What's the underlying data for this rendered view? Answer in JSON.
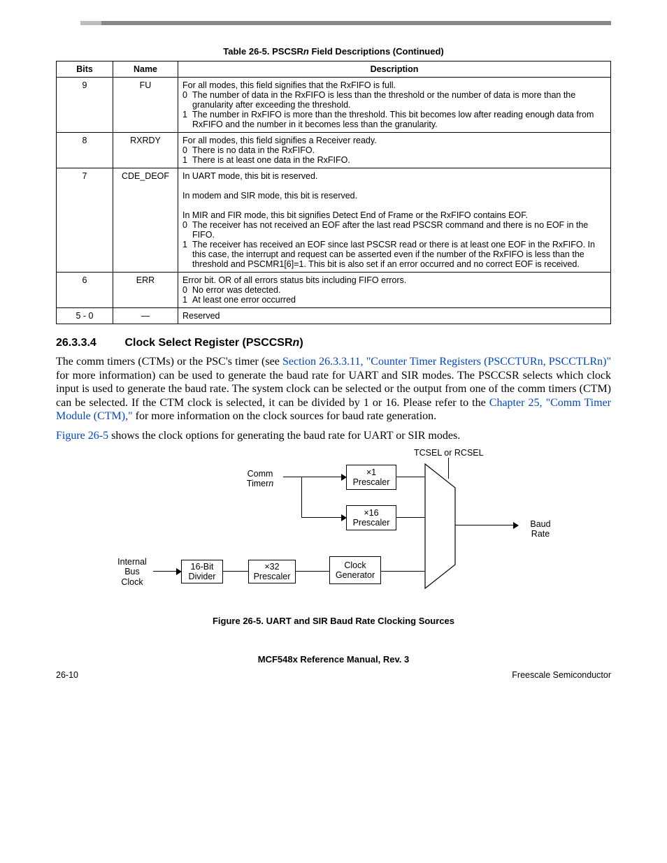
{
  "tableCaption": "Table 26-5. PSCSRn Field Descriptions (Continued)",
  "tableCaptionItalic": "n",
  "th": {
    "bits": "Bits",
    "name": "Name",
    "desc": "Description"
  },
  "rows": [
    {
      "bits": "9",
      "name": "FU",
      "lead": "For all modes, this field signifies that the RxFIFO is full.",
      "items": [
        {
          "n": "0",
          "t": "The number of data in the RxFIFO is less than the threshold or the number of data is more than the granularity after exceeding the threshold."
        },
        {
          "n": "1",
          "t": "The number in RxFIFO is more than the threshold. This bit becomes low after reading enough data from RxFIFO and the number in it becomes less than the granularity."
        }
      ]
    },
    {
      "bits": "8",
      "name": "RXRDY",
      "lead": "For all modes, this field signifies a Receiver ready.",
      "items": [
        {
          "n": "0",
          "t": "There is no data in the RxFIFO."
        },
        {
          "n": "1",
          "t": "There is at least one data in the RxFIFO."
        }
      ]
    },
    {
      "bits": "7",
      "name": "CDE_DEOF",
      "paras": [
        "In UART mode, this bit is reserved.",
        "In modem and SIR mode, this bit is reserved.",
        "In MIR and FIR mode, this bit signifies Detect End of Frame or the RxFIFO contains EOF."
      ],
      "items": [
        {
          "n": "0",
          "t": "The receiver has not received an EOF after the last read PSCSR command and there is no EOF in the FIFO."
        },
        {
          "n": "1",
          "t": "The receiver has received an EOF since last PSCSR read or there is at least one EOF in the RxFIFO. In this case, the interrupt and request can be asserted even if the number of the RxFIFO is less than the threshold and PSCMR1[6]=1. This bit is also set if an error occurred and no correct EOF is received."
        }
      ]
    },
    {
      "bits": "6",
      "name": "ERR",
      "lead": "Error bit. OR of all errors status bits including FIFO errors.",
      "items": [
        {
          "n": "0",
          "t": "No error was detected."
        },
        {
          "n": "1",
          "t": "At least one error occurred"
        }
      ]
    },
    {
      "bits": "5 - 0",
      "name": "—",
      "lead": "Reserved"
    }
  ],
  "section": {
    "num": "26.3.3.4",
    "title_a": "Clock Select Register (PSCCSR",
    "title_ital": "n",
    "title_b": ")"
  },
  "para1": {
    "a": "The comm timers (CTMs) or the PSC's timer (see ",
    "link1": "Section 26.3.3.11, \"Counter Timer Registers (PSCCTURn, PSCCTLRn)\"",
    "b": " for more information) can be used to generate the baud rate for UART and SIR modes. The PSCCSR selects which clock input is used to generate the baud rate. The system clock can be selected or the output from one of the comm timers (CTM) can be selected. If the CTM clock is selected, it can be divided by 1 or 16. Please refer to the ",
    "link2": "Chapter 25, \"Comm Timer Module (CTM),\"",
    "c": " for more information on the clock sources for baud rate generation."
  },
  "para2": {
    "link": "Figure 26-5",
    "rest": " shows the clock options for generating the baud rate for UART or SIR modes."
  },
  "diagram": {
    "tclabel": "TCSEL or RCSEL",
    "comm": "Comm\nTimern",
    "commItalic": "n",
    "p1": "×1\nPrescaler",
    "p16": "×16\nPrescaler",
    "ibc": "Internal\nBus\nClock",
    "div16": "16-Bit\nDivider",
    "p32": "×32\nPrescaler",
    "cg": "Clock\nGenerator",
    "baud": "Baud Rate"
  },
  "figCaption": "Figure 26-5. UART and SIR Baud Rate Clocking Sources",
  "footerTitle": "MCF548x Reference Manual, Rev. 3",
  "footerLeft": "26-10",
  "footerRight": "Freescale Semiconductor"
}
